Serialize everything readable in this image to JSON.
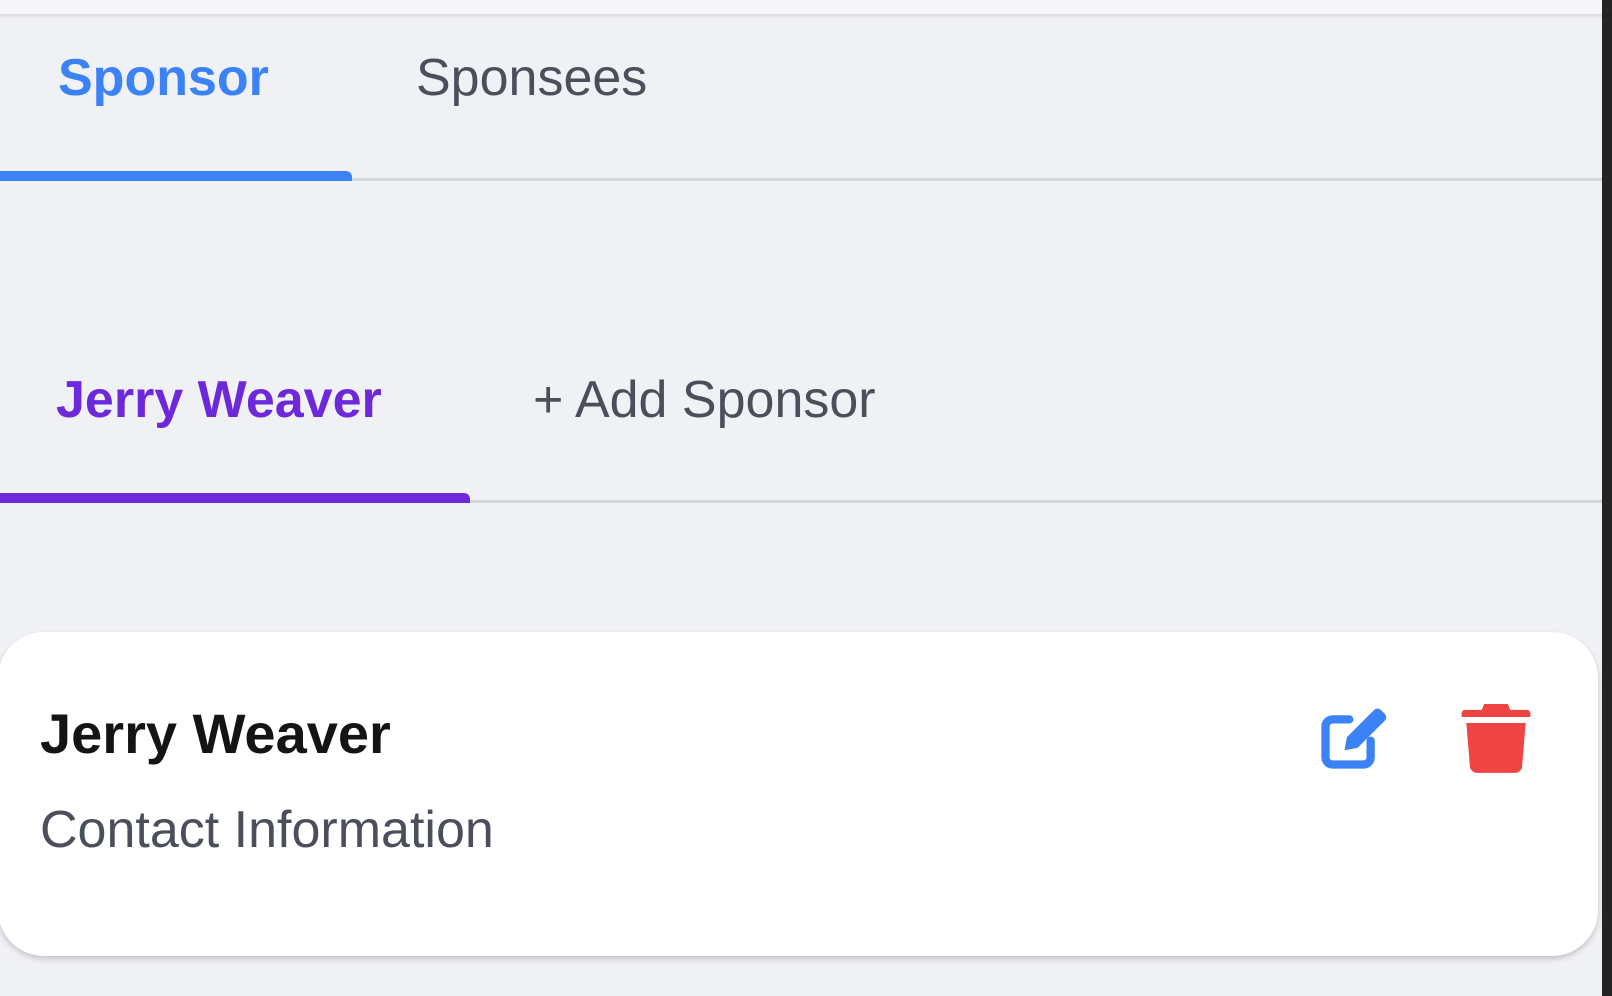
{
  "colors": {
    "primary_accent": "#3b82f6",
    "secondary_accent": "#6d28d9",
    "edit_icon": "#3b82f6",
    "delete_icon": "#ef4444"
  },
  "primary_tabs": [
    {
      "label": "Sponsor",
      "active": true
    },
    {
      "label": "Sponsees",
      "active": false
    }
  ],
  "secondary_tabs": [
    {
      "label": "Jerry Weaver",
      "active": true
    },
    {
      "label": "+ Add Sponsor",
      "active": false
    }
  ],
  "card": {
    "name": "Jerry Weaver",
    "subtitle": "Contact Information",
    "edit_icon": "edit-icon",
    "delete_icon": "trash-icon"
  }
}
